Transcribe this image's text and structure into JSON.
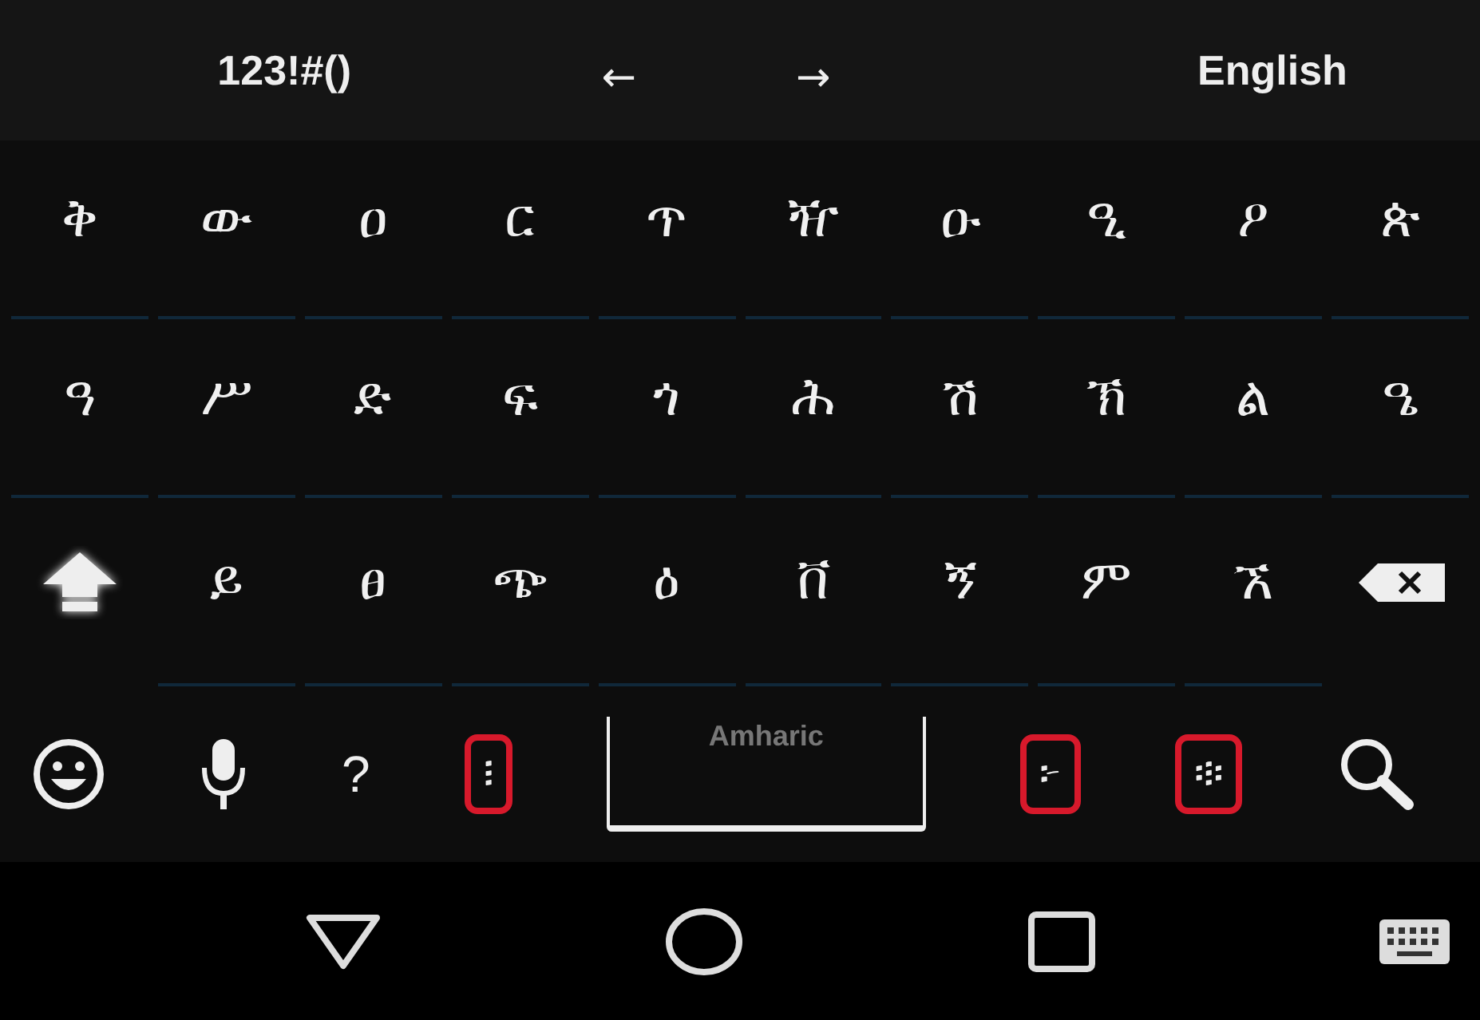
{
  "suggestion_bar": {
    "symbols_label": "123!#()",
    "left_arrow": "←",
    "right_arrow": "→",
    "language_label": "English"
  },
  "rows": [
    {
      "keys": [
        {
          "kind": "char",
          "label": "ቅ"
        },
        {
          "kind": "char",
          "label": "ው"
        },
        {
          "kind": "char",
          "label": "ዐ"
        },
        {
          "kind": "char",
          "label": "ር"
        },
        {
          "kind": "char",
          "label": "ጥ"
        },
        {
          "kind": "char",
          "label": "ዥ"
        },
        {
          "kind": "char",
          "label": "ዑ"
        },
        {
          "kind": "char",
          "label": "ዒ"
        },
        {
          "kind": "char",
          "label": "ዖ"
        },
        {
          "kind": "char",
          "label": "ጵ"
        }
      ]
    },
    {
      "keys": [
        {
          "kind": "char",
          "label": "ዓ"
        },
        {
          "kind": "char",
          "label": "ሥ"
        },
        {
          "kind": "char",
          "label": "ድ"
        },
        {
          "kind": "char",
          "label": "ፍ"
        },
        {
          "kind": "char",
          "label": "ጎ"
        },
        {
          "kind": "char",
          "label": "ሕ"
        },
        {
          "kind": "char",
          "label": "ሽ"
        },
        {
          "kind": "char",
          "label": "ኽ"
        },
        {
          "kind": "char",
          "label": "ል"
        },
        {
          "kind": "char",
          "label": "ዔ"
        }
      ]
    },
    {
      "keys": [
        {
          "kind": "shift"
        },
        {
          "kind": "char",
          "label": "ይ"
        },
        {
          "kind": "char",
          "label": "ፀ"
        },
        {
          "kind": "char",
          "label": "ጭ"
        },
        {
          "kind": "char",
          "label": "ዕ"
        },
        {
          "kind": "char",
          "label": "ቨ"
        },
        {
          "kind": "char",
          "label": "ኝ"
        },
        {
          "kind": "char",
          "label": "ም"
        },
        {
          "kind": "char",
          "label": "ኧ"
        },
        {
          "kind": "backspace"
        }
      ]
    }
  ],
  "bottom_row": [
    {
      "kind": "emoji"
    },
    {
      "kind": "mic"
    },
    {
      "kind": "char",
      "label": "?"
    },
    {
      "kind": "punct",
      "label": "፧"
    },
    {
      "kind": "space",
      "label": "Amharic"
    },
    {
      "kind": "punct",
      "label": "፦"
    },
    {
      "kind": "punct",
      "label": "፨"
    },
    {
      "kind": "search"
    }
  ],
  "nav_bar": [
    {
      "kind": "back"
    },
    {
      "kind": "home"
    },
    {
      "kind": "recents"
    },
    {
      "kind": "keyboard"
    }
  ]
}
